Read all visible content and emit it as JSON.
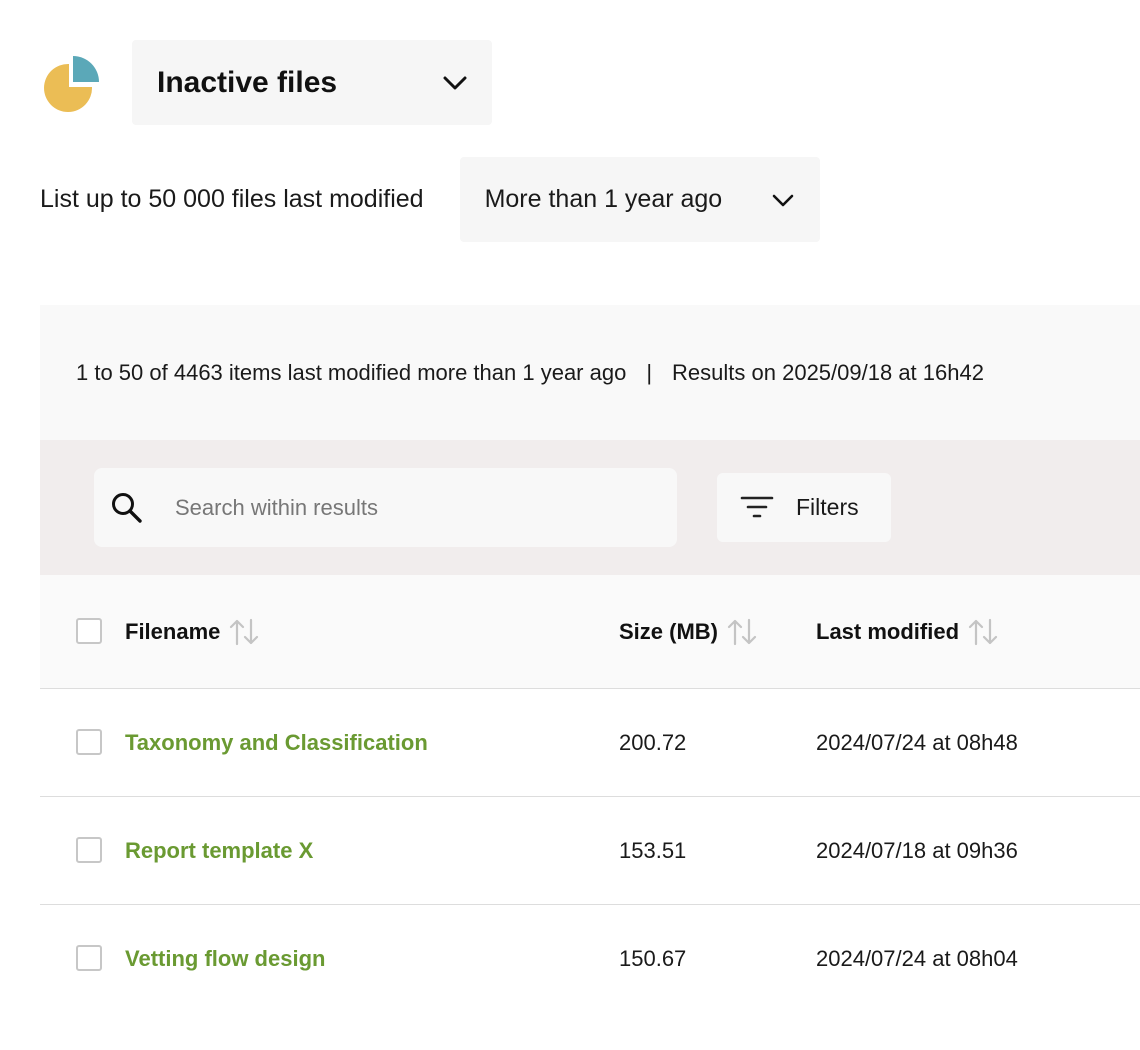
{
  "header": {
    "view_select": {
      "label": "Inactive files",
      "icon": "chevron-down-icon"
    },
    "logo": {
      "icon": "pie-chart-icon",
      "colors": {
        "main": "#EBBD55",
        "slice": "#5BA8B8"
      }
    }
  },
  "period_filter": {
    "prefix": "List up to 50 000 files last modified",
    "selected": "More than 1 year ago"
  },
  "summary": {
    "range_text": "1 to 50 of 4463 items last modified more than 1 year ago",
    "separator": "|",
    "results_text": "Results on 2025/09/18 at 16h42"
  },
  "toolbar": {
    "search": {
      "placeholder": "Search within results",
      "value": "",
      "icon": "search-icon"
    },
    "filters_button": {
      "label": "Filters",
      "icon": "filter-icon"
    }
  },
  "table": {
    "columns": [
      {
        "key": "filename",
        "label": "Filename"
      },
      {
        "key": "size",
        "label": "Size (MB)"
      },
      {
        "key": "modified",
        "label": "Last modified"
      }
    ],
    "rows": [
      {
        "filename": "Taxonomy and Classification",
        "size": "200.72",
        "modified": "2024/07/24 at 08h48"
      },
      {
        "filename": "Report template X",
        "size": "153.51",
        "modified": "2024/07/18 at 09h36"
      },
      {
        "filename": "Vetting flow design",
        "size": "150.67",
        "modified": "2024/07/24 at 08h04"
      }
    ]
  },
  "colors": {
    "link": "#6A9A32",
    "toolbar_bg": "#F1EDED",
    "panel_bg": "#F9F9F9"
  }
}
